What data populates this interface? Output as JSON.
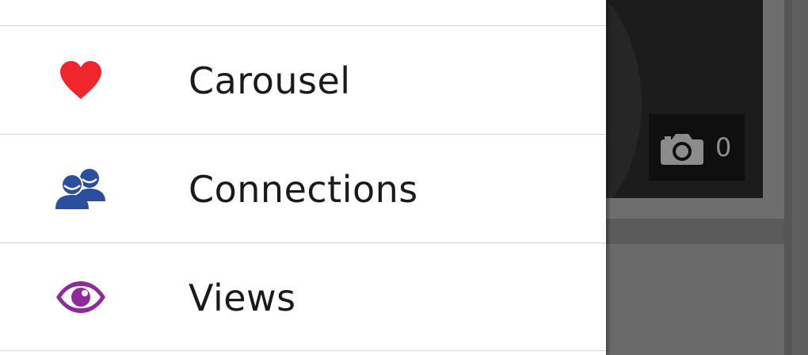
{
  "drawer": {
    "items": [
      {
        "label": "Carousel",
        "icon": "heart-icon",
        "icon_color": "#f0262c"
      },
      {
        "label": "Connections",
        "icon": "people-icon",
        "icon_color": "#2b4f9e"
      },
      {
        "label": "Views",
        "icon": "eye-icon",
        "icon_color": "#8e2b9a"
      }
    ]
  },
  "background": {
    "photo_count": "0",
    "photo_icon": "camera-icon"
  }
}
